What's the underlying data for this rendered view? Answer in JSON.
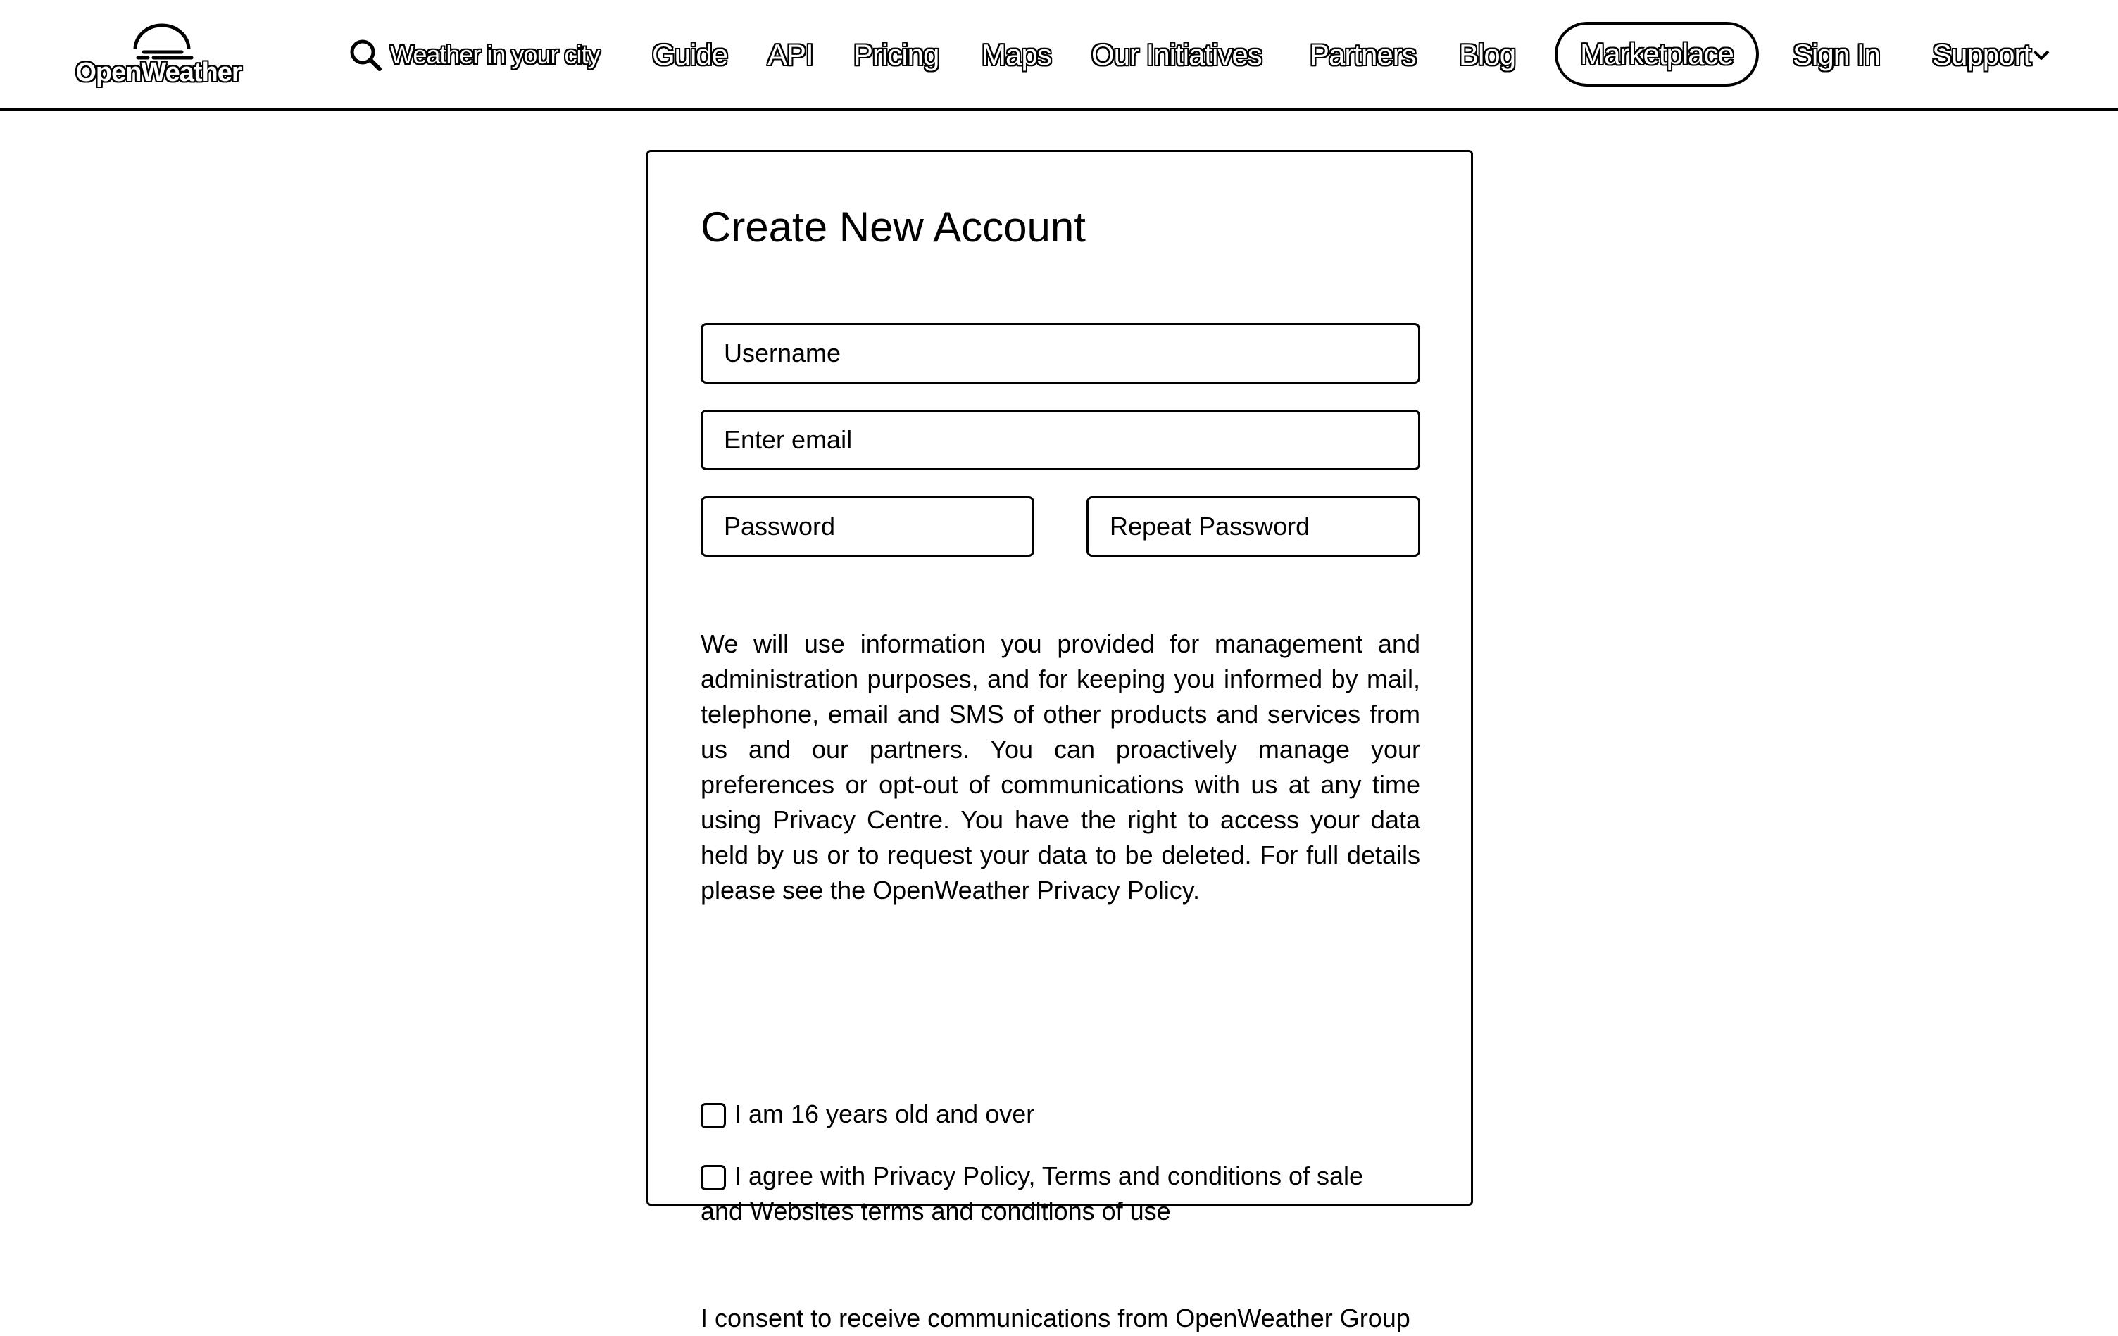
{
  "header": {
    "logo_text": "OpenWeather",
    "search_label": "Weather in your city",
    "nav": {
      "guide": "Guide",
      "api": "API",
      "pricing": "Pricing",
      "maps": "Maps",
      "initiatives": "Our Initiatives",
      "partners": "Partners",
      "blog": "Blog",
      "marketplace": "Marketplace",
      "sign_in": "Sign In",
      "support": "Support"
    },
    "icons": {
      "logo": "openweather-logo-icon",
      "search": "search-icon",
      "support_dropdown": "chevron-down-icon"
    }
  },
  "form": {
    "title": "Create New Account",
    "username_placeholder": "Username",
    "email_placeholder": "Enter email",
    "password_placeholder": "Password",
    "repeat_password_placeholder": "Repeat Password",
    "info_text": "We will use information you provided for management and administration purposes, and for keeping you informed by mail, telephone, email and SMS of other products and services from us and our partners. You can proactively manage your preferences or opt-out of communications with us at any time using Privacy Centre. You have the right to access your data held by us or to request your data to be deleted. For full details please see the OpenWeather Privacy Policy.",
    "age_checkbox_label": "I am 16 years old and over",
    "agree_checkbox_label": "I agree with Privacy Policy, Terms and conditions of sale and Websites terms and conditions of use",
    "age_checked": false,
    "agree_checked": false,
    "consent_text": "I consent to receive communications from OpenWeather Group"
  }
}
